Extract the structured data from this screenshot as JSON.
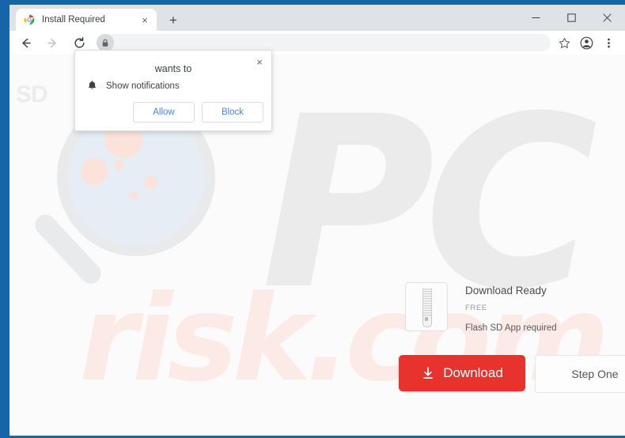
{
  "browser": {
    "tab": {
      "title": "Install Required",
      "favicon": "chrome-favicon",
      "close_label": "×"
    },
    "new_tab_label": "+",
    "window_controls": {
      "minimize": "minimize-icon",
      "maximize": "maximize-icon",
      "close": "close-icon"
    },
    "toolbar": {
      "back": "back-arrow-icon",
      "forward": "forward-arrow-icon",
      "reload": "reload-icon",
      "site_info": "lock-icon",
      "url": "",
      "url_placeholder": "",
      "bookmark": "star-icon",
      "profile": "profile-avatar-icon",
      "menu": "three-dot-menu-icon"
    }
  },
  "permission_dialog": {
    "title": "wants to",
    "close_label": "×",
    "permission_icon": "bell-icon",
    "permission_label": "Show notifications",
    "allow_label": "Allow",
    "block_label": "Block"
  },
  "page": {
    "site_logo": "SD",
    "watermark_primary": "PC",
    "watermark_secondary": "risk.com",
    "product": {
      "icon": "zipper-file-icon",
      "title": "Download Ready",
      "price": "FREE",
      "requirement": "Flash SD App required"
    },
    "download_button": {
      "label": "Download",
      "icon": "download-arrow-icon"
    },
    "step_box": {
      "label": "Step One"
    }
  },
  "colors": {
    "window_frame": "#1565a8",
    "download_red": "#e8322d",
    "link_blue": "#4285f4",
    "watermark_gray": "#ebebeb",
    "watermark_pink": "#fbeae6"
  }
}
